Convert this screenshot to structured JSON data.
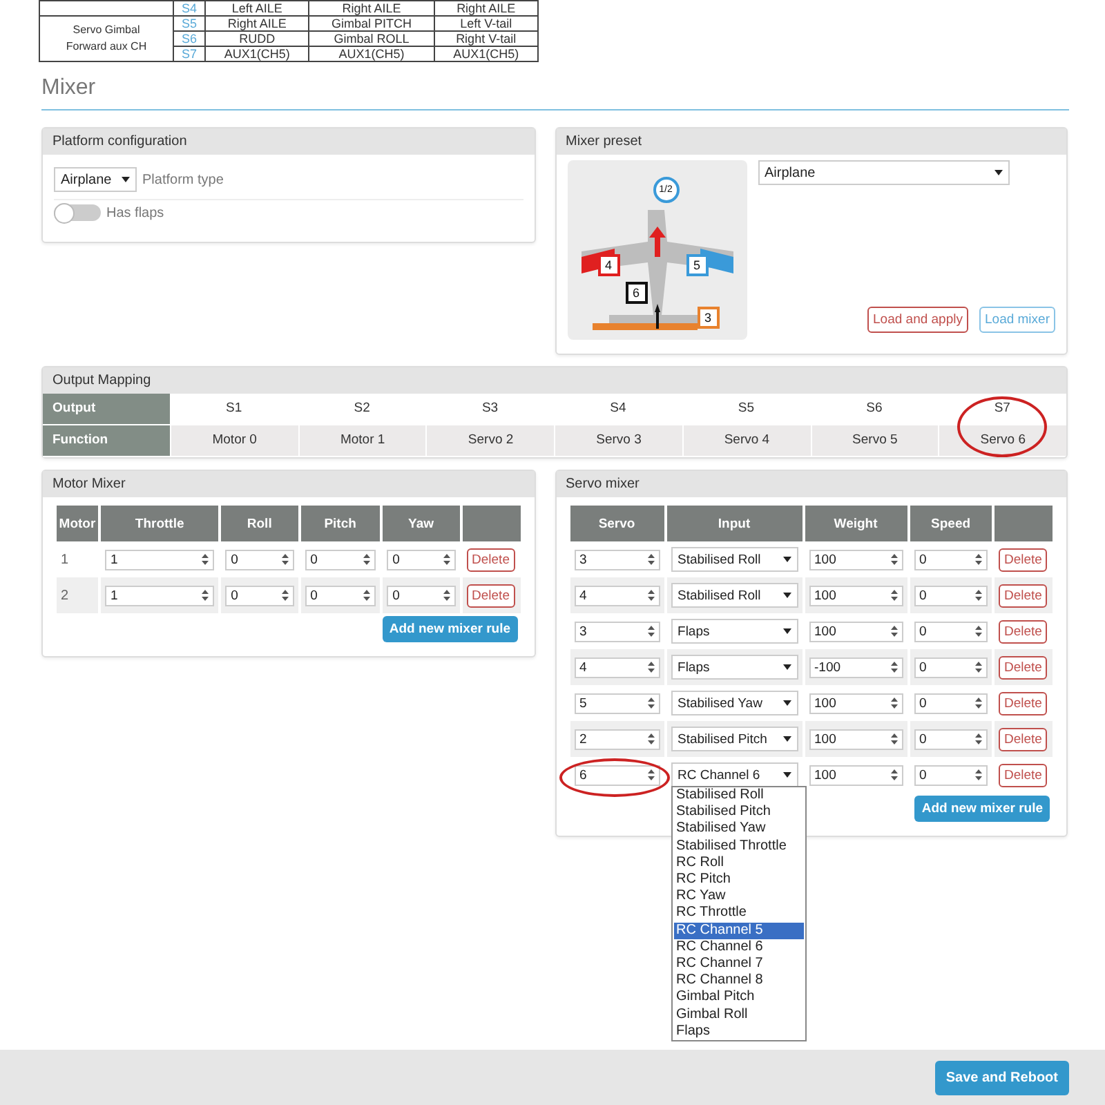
{
  "top_table": {
    "groups": [
      {
        "rows": [
          {
            "output": "S4",
            "cells": [
              "Left AILE",
              "Right AILE",
              "Right AILE"
            ]
          }
        ]
      },
      {
        "label": "Servo Gimbal Forward aux CH",
        "rows": [
          {
            "output": "S5",
            "cells": [
              "Right AILE",
              "Gimbal PITCH",
              "Left V-tail"
            ]
          },
          {
            "output": "S6",
            "cells": [
              "RUDD",
              "Gimbal ROLL",
              "Right V-tail"
            ]
          },
          {
            "output": "S7",
            "cells": [
              "AUX1(CH5)",
              "AUX1(CH5)",
              "AUX1(CH5)"
            ]
          }
        ]
      }
    ]
  },
  "page_title": "Mixer",
  "platform": {
    "title": "Platform configuration",
    "type_value": "Airplane",
    "type_label": "Platform type",
    "flaps": {
      "label": "Has flaps",
      "on": false
    }
  },
  "preset": {
    "title": "Mixer preset",
    "value": "Airplane",
    "diagram_labels": [
      {
        "text": "1/2",
        "kind": "motor",
        "color": "#3a9ad9"
      },
      {
        "text": "4",
        "kind": "servo",
        "color": "#e02020"
      },
      {
        "text": "5",
        "kind": "servo",
        "color": "#3a9ad9"
      },
      {
        "text": "6",
        "kind": "servo",
        "color": "#111111"
      },
      {
        "text": "3",
        "kind": "servo",
        "color": "#e8822e"
      }
    ],
    "buttons": [
      {
        "label": "Load and apply",
        "kind": "danger"
      },
      {
        "label": "Load mixer",
        "kind": "info"
      }
    ]
  },
  "output_mapping": {
    "title": "Output Mapping",
    "output_label": "Output",
    "function_label": "Function",
    "items": [
      {
        "output": "S1",
        "function": "Motor 0",
        "circled": false
      },
      {
        "output": "S2",
        "function": "Motor 1",
        "circled": false
      },
      {
        "output": "S3",
        "function": "Servo 2",
        "circled": false
      },
      {
        "output": "S4",
        "function": "Servo 3",
        "circled": false
      },
      {
        "output": "S5",
        "function": "Servo 4",
        "circled": false
      },
      {
        "output": "S6",
        "function": "Servo 5",
        "circled": false
      },
      {
        "output": "S7",
        "function": "Servo 6",
        "circled": true
      }
    ]
  },
  "motor_mixer": {
    "title": "Motor Mixer",
    "columns": [
      "Motor",
      "Throttle",
      "Roll",
      "Pitch",
      "Yaw"
    ],
    "rows": [
      {
        "motor": "1",
        "values": [
          "1",
          "0",
          "0",
          "0"
        ],
        "delete": "Delete"
      },
      {
        "motor": "2",
        "values": [
          "1",
          "0",
          "0",
          "0"
        ],
        "delete": "Delete"
      }
    ],
    "add_button": "Add new mixer rule"
  },
  "servo_mixer": {
    "title": "Servo mixer",
    "columns": [
      "Servo",
      "Input",
      "Weight",
      "Speed"
    ],
    "rows": [
      {
        "servo": "3",
        "input": "Stabilised Roll",
        "weight": "100",
        "speed": "0",
        "delete": "Delete",
        "circled": false
      },
      {
        "servo": "4",
        "input": "Stabilised Roll",
        "weight": "100",
        "speed": "0",
        "delete": "Delete",
        "circled": false
      },
      {
        "servo": "3",
        "input": "Flaps",
        "weight": "100",
        "speed": "0",
        "delete": "Delete",
        "circled": false
      },
      {
        "servo": "4",
        "input": "Flaps",
        "weight": "-100",
        "speed": "0",
        "delete": "Delete",
        "circled": false
      },
      {
        "servo": "5",
        "input": "Stabilised Yaw",
        "weight": "100",
        "speed": "0",
        "delete": "Delete",
        "circled": false
      },
      {
        "servo": "2",
        "input": "Stabilised Pitch",
        "weight": "100",
        "speed": "0",
        "delete": "Delete",
        "circled": false
      },
      {
        "servo": "6",
        "input": "RC Channel 6",
        "weight": "100",
        "speed": "0",
        "delete": "Delete",
        "circled": true
      }
    ],
    "add_button": "Add new mixer rule",
    "dropdown": [
      {
        "label": "Stabilised Roll",
        "selected": false
      },
      {
        "label": "Stabilised Pitch",
        "selected": false
      },
      {
        "label": "Stabilised Yaw",
        "selected": false
      },
      {
        "label": "Stabilised Throttle",
        "selected": false
      },
      {
        "label": "RC Roll",
        "selected": false
      },
      {
        "label": "RC Pitch",
        "selected": false
      },
      {
        "label": "RC Yaw",
        "selected": false
      },
      {
        "label": "RC Throttle",
        "selected": false
      },
      {
        "label": "RC Channel 5",
        "selected": true
      },
      {
        "label": "RC Channel 6",
        "selected": false
      },
      {
        "label": "RC Channel 7",
        "selected": false
      },
      {
        "label": "RC Channel 8",
        "selected": false
      },
      {
        "label": "Gimbal Pitch",
        "selected": false
      },
      {
        "label": "Gimbal Roll",
        "selected": false
      },
      {
        "label": "Flaps",
        "selected": false
      }
    ]
  },
  "save_button": "Save and Reboot"
}
